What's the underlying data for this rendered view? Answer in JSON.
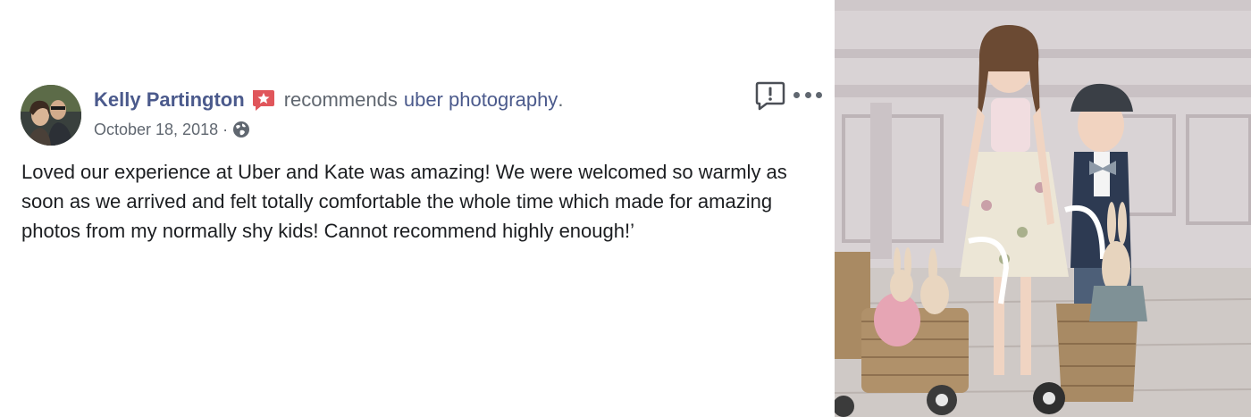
{
  "review": {
    "author": "Kelly Partington",
    "verb": "recommends",
    "page_name": "uber photography",
    "period": ".",
    "date": "October 18, 2018",
    "separator": "·",
    "audience_icon": "globe-icon",
    "badge_icon": "recommendation-star-badge-icon",
    "text": "Loved our experience at Uber and Kate was amazing! We were welcomed so warmly as soon as we arrived and felt totally comfortable the whole time which made for amazing photos from my normally shy kids! Cannot recommend highly enough!’",
    "actions": {
      "report_icon": "report-exclamation-icon",
      "more_icon": "more-options-icon"
    }
  },
  "colors": {
    "link": "#4b5a8c",
    "meta": "#606770",
    "text": "#1c1e21",
    "badge": "#e0565b"
  }
}
